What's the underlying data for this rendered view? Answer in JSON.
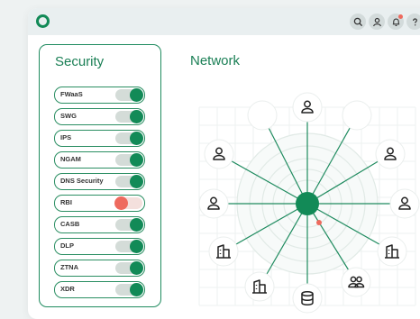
{
  "security": {
    "title": "Security",
    "toggles": [
      {
        "label": "FWaaS",
        "on": true
      },
      {
        "label": "SWG",
        "on": true
      },
      {
        "label": "IPS",
        "on": true
      },
      {
        "label": "NGAM",
        "on": true
      },
      {
        "label": "DNS Security",
        "on": true
      },
      {
        "label": "RBI",
        "on": false
      },
      {
        "label": "CASB",
        "on": true
      },
      {
        "label": "DLP",
        "on": true
      },
      {
        "label": "ZTNA",
        "on": true
      },
      {
        "label": "XDR",
        "on": true
      }
    ]
  },
  "network": {
    "title": "Network",
    "nodes": [
      {
        "icon": "empty-node"
      },
      {
        "icon": "user-icon"
      },
      {
        "icon": "empty-node"
      },
      {
        "icon": "user-icon"
      },
      {
        "icon": "user-icon"
      },
      {
        "icon": "user-icon"
      },
      {
        "icon": "user-icon"
      },
      {
        "icon": "building-icon"
      },
      {
        "icon": "building-icon"
      },
      {
        "icon": "building-icon"
      },
      {
        "icon": "users-icon"
      },
      {
        "icon": "database-icon"
      }
    ]
  },
  "colors": {
    "accent": "#128a57",
    "alert": "#ee6a5e",
    "topbar": "#e9eff0"
  }
}
